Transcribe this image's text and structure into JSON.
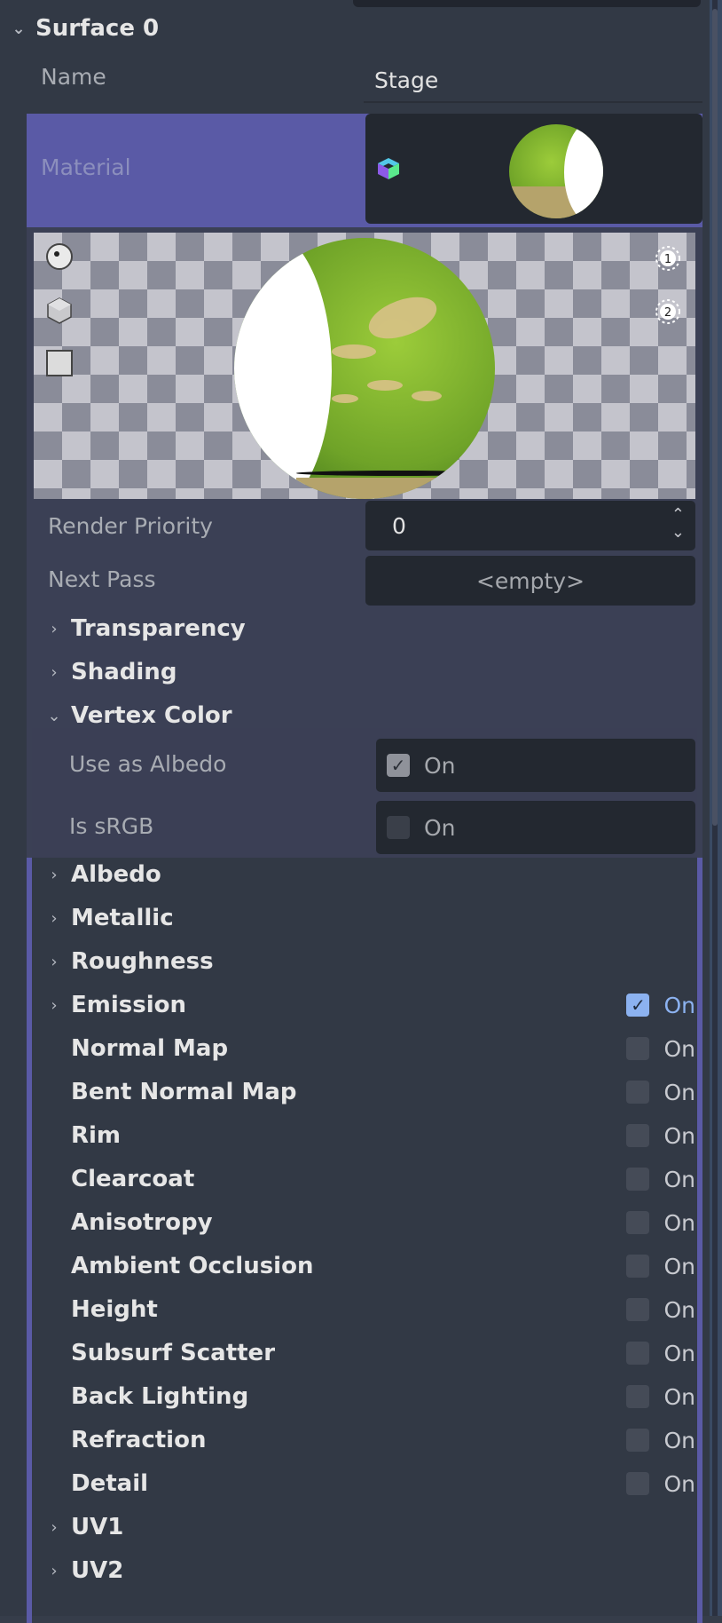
{
  "surface": {
    "title": "Surface 0"
  },
  "name_row": {
    "label": "Name",
    "value": "Stage"
  },
  "material": {
    "label": "Material"
  },
  "preview": {
    "light_1": "1",
    "light_2": "2"
  },
  "render_priority": {
    "label": "Render Priority",
    "value": "0"
  },
  "next_pass": {
    "label": "Next Pass",
    "value": "<empty>"
  },
  "sections_top": [
    {
      "label": "Transparency"
    },
    {
      "label": "Shading"
    }
  ],
  "vertex_color": {
    "label": "Vertex Color",
    "use_as_albedo": {
      "label": "Use as Albedo",
      "toggle": "On",
      "checked": true
    },
    "is_srgb": {
      "label": "Is sRGB",
      "toggle": "On",
      "checked": false
    }
  },
  "sections": [
    {
      "label": "Albedo",
      "expandable": true
    },
    {
      "label": "Metallic",
      "expandable": true
    },
    {
      "label": "Roughness",
      "expandable": true
    },
    {
      "label": "Emission",
      "expandable": true,
      "toggle": "On",
      "checked": true
    },
    {
      "label": "Normal Map",
      "toggle": "On",
      "checked": false
    },
    {
      "label": "Bent Normal Map",
      "toggle": "On",
      "checked": false
    },
    {
      "label": "Rim",
      "toggle": "On",
      "checked": false
    },
    {
      "label": "Clearcoat",
      "toggle": "On",
      "checked": false
    },
    {
      "label": "Anisotropy",
      "toggle": "On",
      "checked": false
    },
    {
      "label": "Ambient Occlusion",
      "toggle": "On",
      "checked": false
    },
    {
      "label": "Height",
      "toggle": "On",
      "checked": false
    },
    {
      "label": "Subsurf Scatter",
      "toggle": "On",
      "checked": false
    },
    {
      "label": "Back Lighting",
      "toggle": "On",
      "checked": false
    },
    {
      "label": "Refraction",
      "toggle": "On",
      "checked": false
    },
    {
      "label": "Detail",
      "toggle": "On",
      "checked": false
    },
    {
      "label": "UV1",
      "expandable": true
    },
    {
      "label": "UV2",
      "expandable": true
    }
  ],
  "colors": {
    "accent_blue": "#8cb2f0",
    "material_highlight": "#5a5aa6"
  }
}
